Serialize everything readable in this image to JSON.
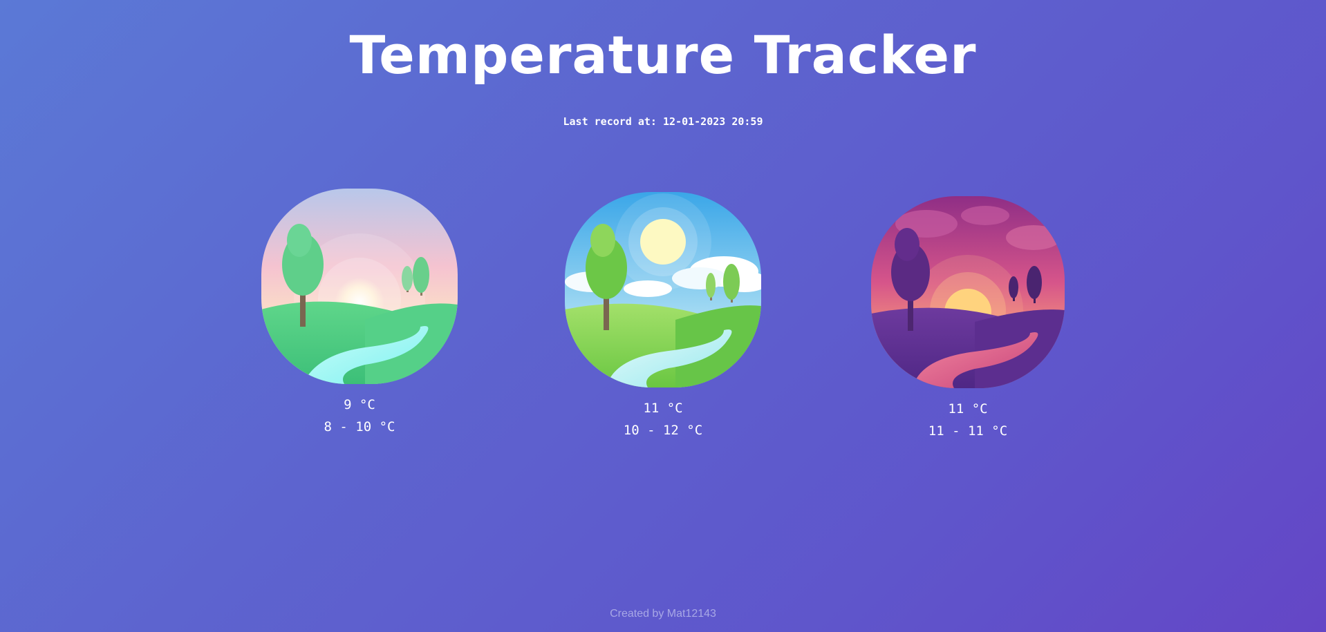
{
  "header": {
    "title": "Temperature Tracker",
    "last_record": "Last record at: 12-01-2023 20:59"
  },
  "cards": [
    {
      "id": "morning",
      "image": "morning-landscape-illustration",
      "temp": "9 °C",
      "range": "8 - 10 °C"
    },
    {
      "id": "day",
      "image": "sunny-day-landscape-illustration",
      "temp": "11 °C",
      "range": "10 - 12 °C"
    },
    {
      "id": "evening",
      "image": "sunset-evening-landscape-illustration",
      "temp": "11 °C",
      "range": "11 - 11 °C"
    }
  ],
  "footer": {
    "credit": "Created by Mat12143"
  },
  "colors": {
    "background_start": "#5b79d6",
    "background_end": "#6446c6",
    "text": "#ffffff",
    "footer_text": "#a8a8e6"
  }
}
